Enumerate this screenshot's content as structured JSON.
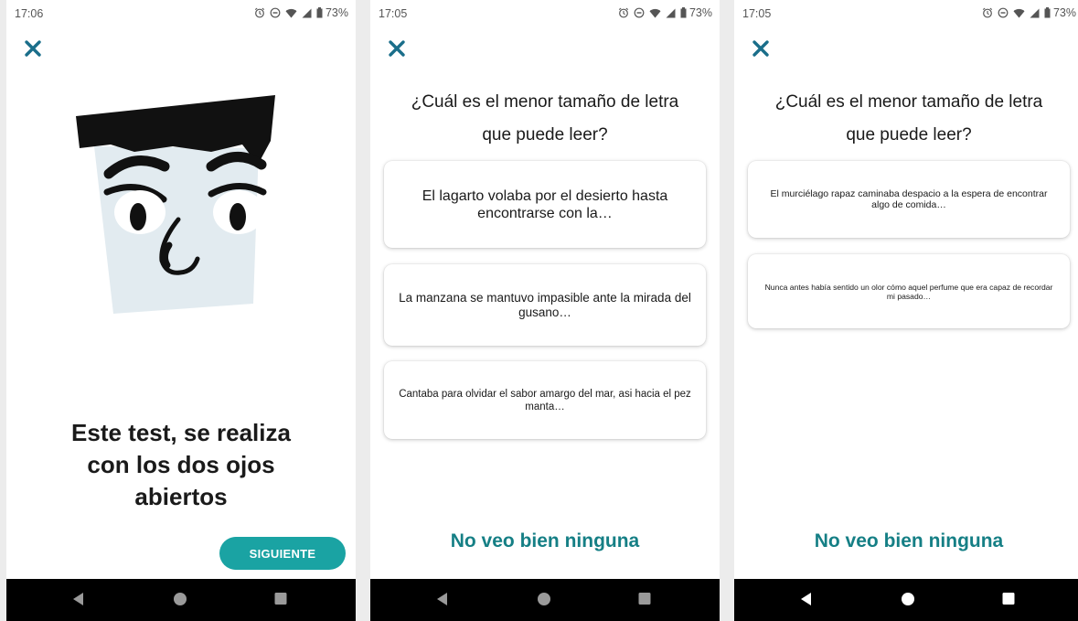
{
  "screens": [
    {
      "status_time": "17:06",
      "battery_text": "73%",
      "intro_line1": "Este test, se realiza",
      "intro_line2": "con los dos ojos",
      "intro_line3": "abiertos",
      "next_label": "SIGUIENTE"
    },
    {
      "status_time": "17:05",
      "battery_text": "73%",
      "question_line1": "¿Cuál es el menor tamaño de letra",
      "question_line2": "que puede leer?",
      "options": [
        "El lagarto volaba por el desierto hasta encontrarse con la…",
        "La manzana se mantuvo impasible ante la mirada del gusano…",
        "Cantaba para olvidar el sabor amargo del mar, asi hacia el pez manta…"
      ],
      "none_label": "No veo bien ninguna"
    },
    {
      "status_time": "17:05",
      "battery_text": "73%",
      "question_line1": "¿Cuál es el menor tamaño de letra",
      "question_line2": "que puede leer?",
      "options": [
        "El murciélago rapaz caminaba despacio a la espera de encontrar algo de comida…",
        "Nunca antes había sentido un olor cómo aquel perfume que era capaz de recordar mi pasado…"
      ],
      "none_label": "No veo bien ninguna"
    }
  ],
  "colors": {
    "accent": "#157f85",
    "button_bg": "#1aa3a3",
    "close_icon": "#1a6e8a",
    "face_bg": "#e2ebf0"
  },
  "icons": {
    "close": "close-icon",
    "alarm": "alarm-icon",
    "dnd": "do-not-disturb-icon",
    "wifi": "wifi-icon",
    "signal": "signal-icon",
    "battery": "battery-icon",
    "back": "back-icon",
    "home": "home-icon",
    "recents": "recents-icon"
  }
}
